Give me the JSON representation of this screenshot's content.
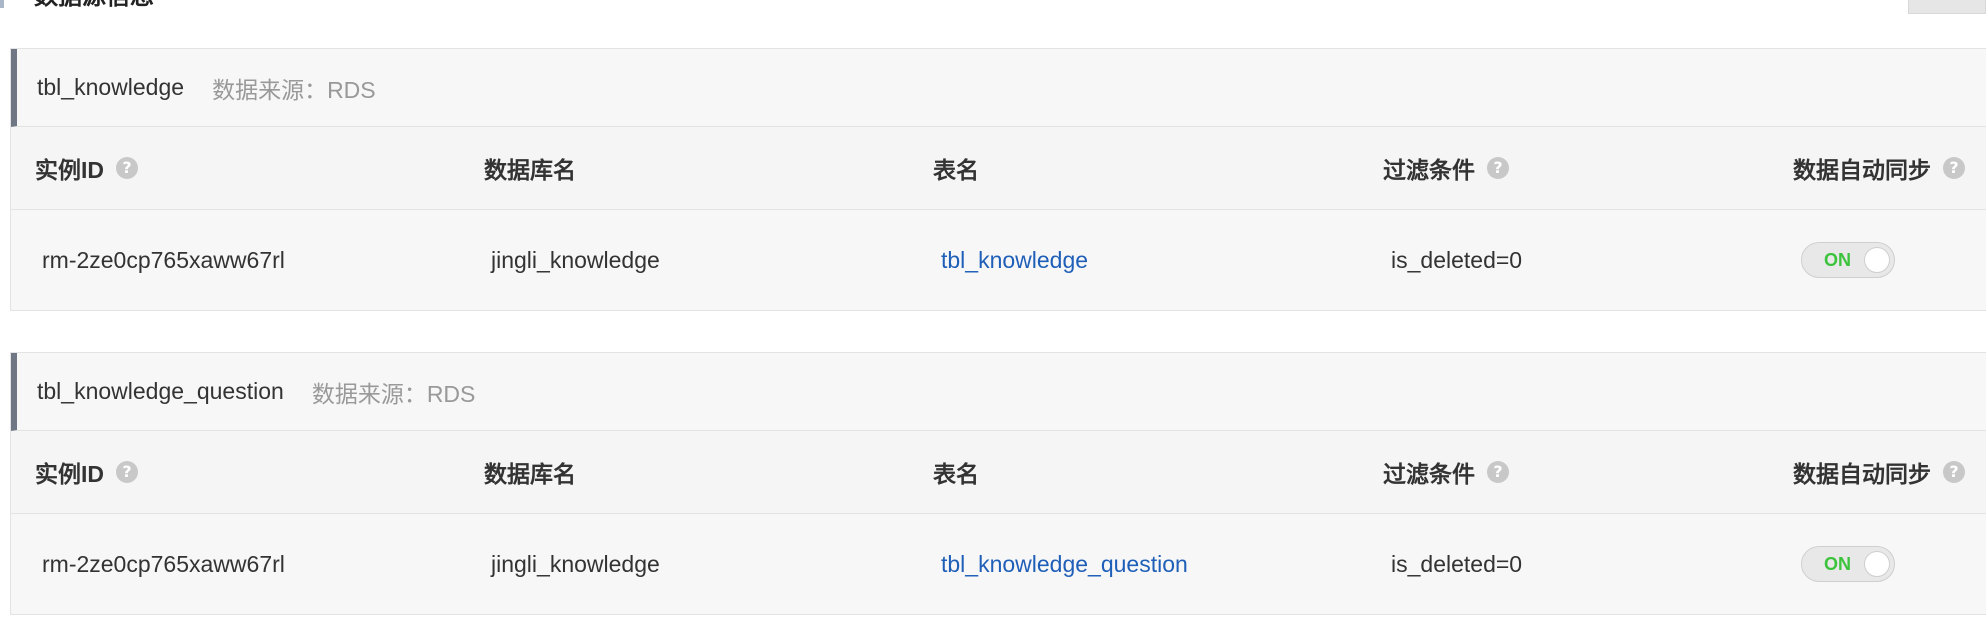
{
  "page": {
    "title": "数据源信息"
  },
  "columns": {
    "instance_id": "实例ID",
    "database": "数据库名",
    "table": "表名",
    "filter": "过滤条件",
    "sync": "数据自动同步"
  },
  "help_icon_glyph": "?",
  "sources": [
    {
      "name": "tbl_knowledge",
      "source_label": "数据来源：RDS",
      "instance_id": "rm-2ze0cp765xaww67rl",
      "database": "jingli_knowledge",
      "table": "tbl_knowledge",
      "filter": "is_deleted=0",
      "sync_label": "ON",
      "sync_on": true
    },
    {
      "name": "tbl_knowledge_question",
      "source_label": "数据来源：RDS",
      "instance_id": "rm-2ze0cp765xaww67rl",
      "database": "jingli_knowledge",
      "table": "tbl_knowledge_question",
      "filter": "is_deleted=0",
      "sync_label": "ON",
      "sync_on": true
    }
  ],
  "colors": {
    "link": "#1f5fb8",
    "toggle_on": "#3cc33c",
    "panel_accent": "#6f7684"
  }
}
